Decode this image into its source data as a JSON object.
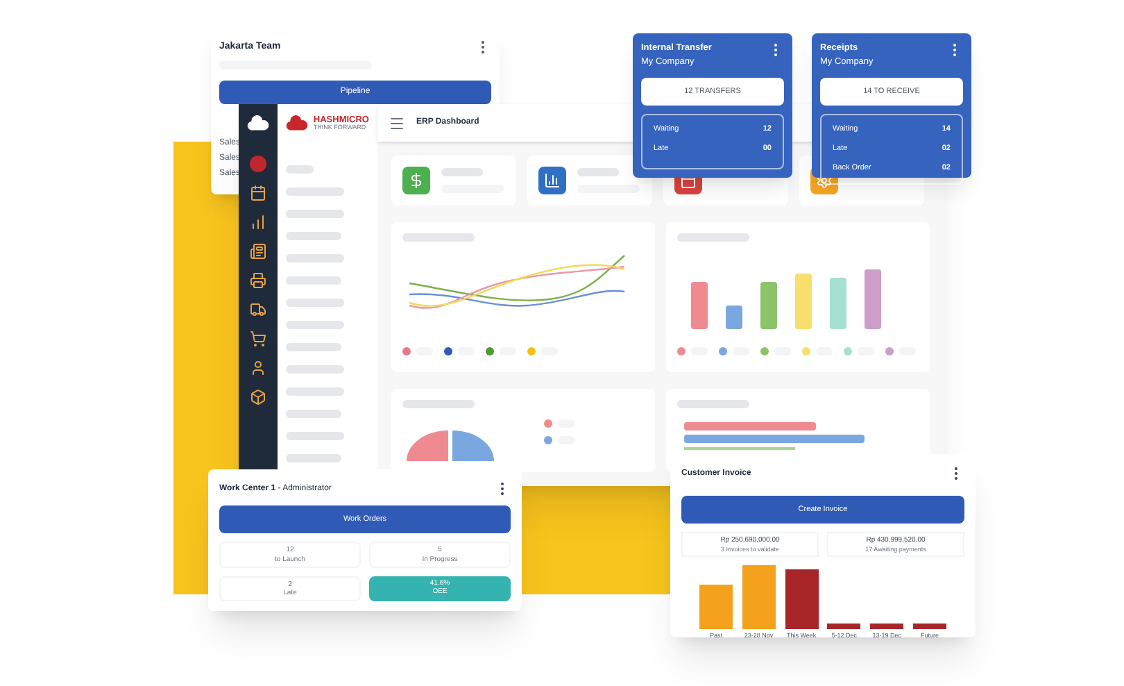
{
  "jakarta_card": {
    "title": "Jakarta Team",
    "button": "Pipeline",
    "rows": [
      "Sales",
      "Sales",
      "Sales"
    ]
  },
  "dashboard": {
    "logo": "HASHMICRO",
    "tagline": "THINK FORWARD",
    "title": "ERP Dashboard"
  },
  "transfer_cards": [
    {
      "title": "Internal Transfer",
      "company": "My Company",
      "button": "12 TRANSFERS",
      "stats": [
        {
          "label": "Waiting",
          "value": "12"
        },
        {
          "label": "Late",
          "value": "00"
        }
      ]
    },
    {
      "title": "Receipts",
      "company": "My Company",
      "button": "14 TO RECEIVE",
      "stats": [
        {
          "label": "Waiting",
          "value": "14"
        },
        {
          "label": "Late",
          "value": "02"
        },
        {
          "label": "Back Order",
          "value": "02"
        }
      ]
    }
  ],
  "work_center": {
    "title": "Work Center 1",
    "role": "- Administrator",
    "button": "Work Orders",
    "tiles": [
      {
        "value": "12",
        "label": "to Launch",
        "highlighted": false
      },
      {
        "value": "5",
        "label": "In Progress",
        "highlighted": false
      },
      {
        "value": "2",
        "label": "Late",
        "highlighted": false
      },
      {
        "value": "41.6%",
        "label": "OEE",
        "highlighted": true
      }
    ]
  },
  "invoice": {
    "title": "Customer Invoice",
    "button": "Create Invoice",
    "totals": [
      {
        "amount": "Rp 250,690,000.00",
        "caption": "3 Invoices to validate"
      },
      {
        "amount": "Rp 430,999,520.00",
        "caption": "17 Awaiting payments"
      }
    ],
    "bars": [
      {
        "label": "Past",
        "color": "#f4a11e"
      },
      {
        "label": "23-28 Nov",
        "color": "#f4a11e"
      },
      {
        "label": "This Week",
        "color": "#a8252a"
      },
      {
        "label": "5-12 Dec",
        "color": "#a8252a"
      },
      {
        "label": "13-19 Dec",
        "color": "#a8252a"
      },
      {
        "label": "Future",
        "color": "#a8252a"
      }
    ]
  }
}
